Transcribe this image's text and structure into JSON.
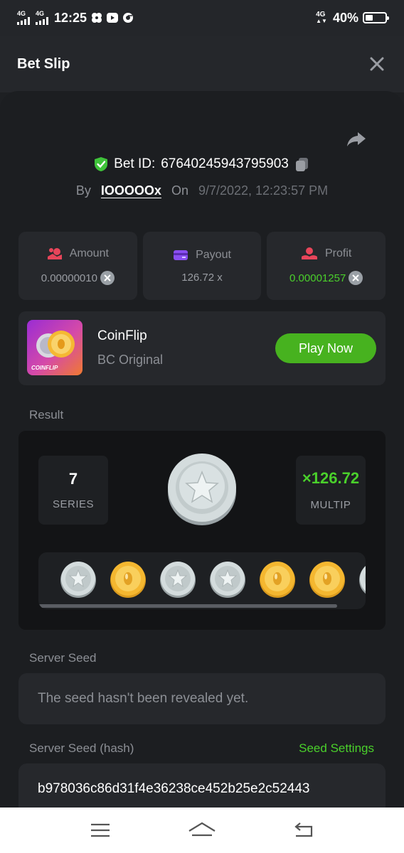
{
  "status_bar": {
    "network1": "4G",
    "network2": "4G",
    "time": "12:25",
    "network3": "4G",
    "battery": "40%",
    "battery_level": 0.4
  },
  "header": {
    "title": "Bet Slip"
  },
  "bet": {
    "id_label": "Bet ID:",
    "id_value": "67640245943795903",
    "by_label": "By",
    "username": "IOOOOOx",
    "on_label": "On",
    "date": "9/7/2022, 12:23:57 PM"
  },
  "stats": {
    "amount_label": "Amount",
    "amount_value": "0.00000010",
    "payout_label": "Payout",
    "payout_value": "126.72 x",
    "profit_label": "Profit",
    "profit_value": "0.00001257"
  },
  "game": {
    "thumb_label": "COINFLIP",
    "name": "CoinFlip",
    "subtitle": "BC Original",
    "play_label": "Play Now"
  },
  "result": {
    "section_label": "Result",
    "series_value": "7",
    "series_label": "SERIES",
    "multiplier_value": "×126.72",
    "multiplier_label": "MULTIP",
    "history": [
      "silver",
      "gold",
      "silver",
      "silver",
      "gold",
      "gold",
      "silver"
    ]
  },
  "server_seed": {
    "label": "Server Seed",
    "value": "The seed hasn't been revealed yet."
  },
  "server_seed_hash": {
    "label": "Server Seed (hash)",
    "settings_link": "Seed Settings",
    "value": "b978036c86d31f4e36238ce452b25e2c52443"
  },
  "colors": {
    "accent_green": "#4ad02b",
    "button_green": "#47b21f",
    "background": "#1c1e21",
    "card": "#26282c"
  }
}
